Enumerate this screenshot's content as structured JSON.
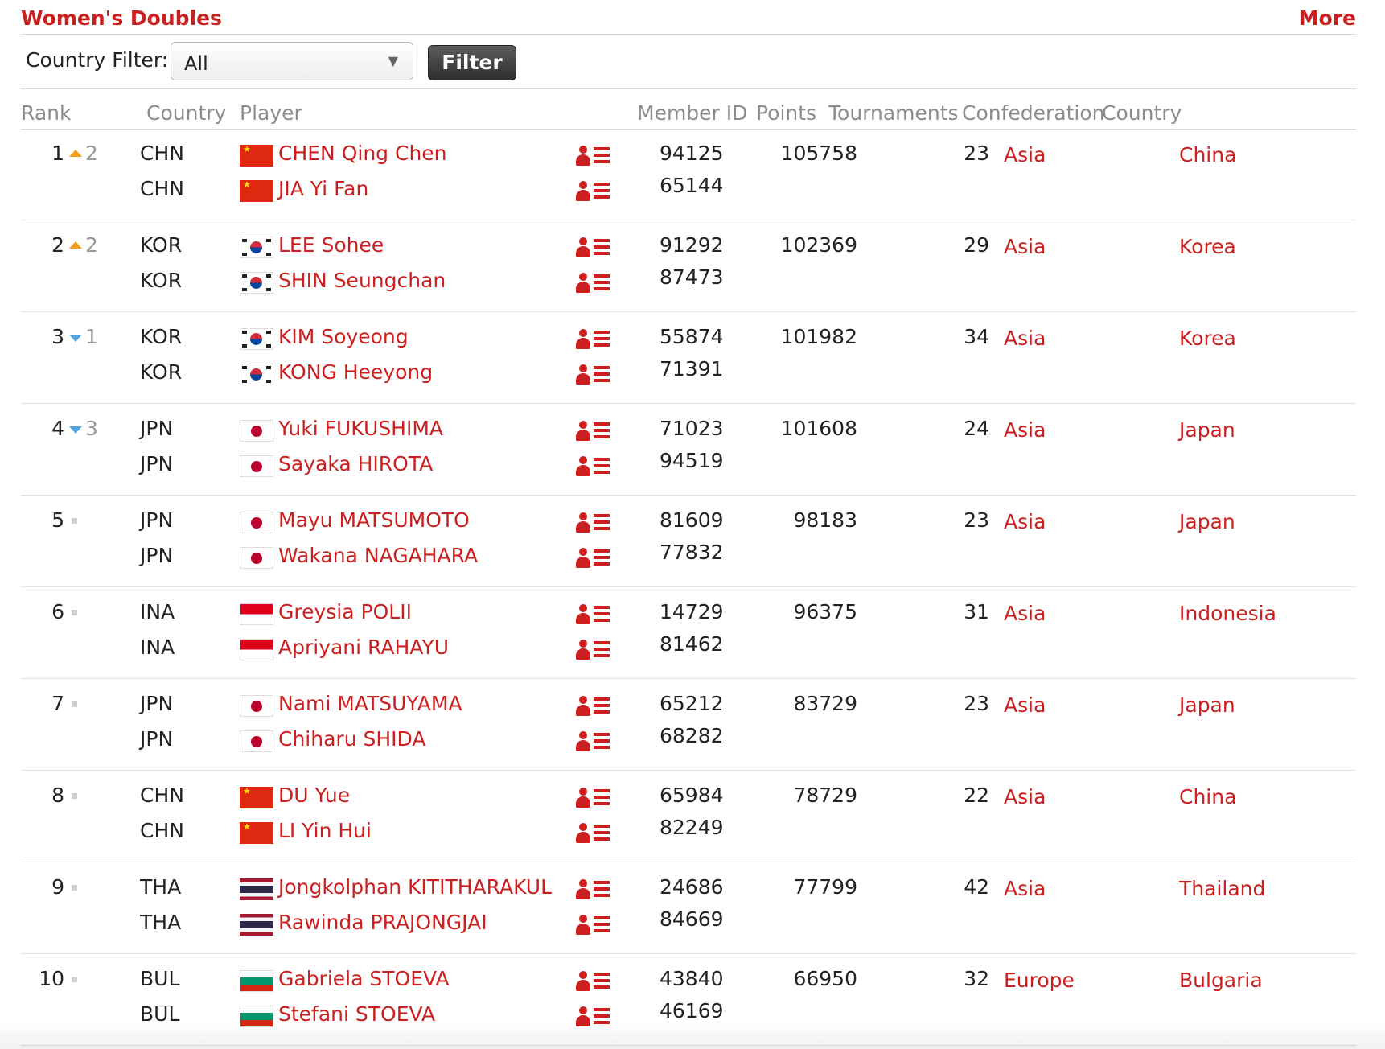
{
  "header": {
    "title": "Women's Doubles",
    "more": "More"
  },
  "filter": {
    "label": "Country Filter:",
    "selected": "All",
    "button": "Filter"
  },
  "columns": {
    "rank": "Rank",
    "country_code": "Country",
    "player": "Player",
    "member_id": "Member ID",
    "points": "Points",
    "tournaments": "Tournaments",
    "confederation": "Confederation",
    "country": "Country"
  },
  "rows": [
    {
      "rank": "1",
      "move": "up",
      "move_by": "2",
      "points": "105758",
      "tournaments": "23",
      "confederation": "Asia",
      "country": "China",
      "players": [
        {
          "code": "CHN",
          "flag": "chn",
          "name": "CHEN Qing Chen",
          "member_id": "94125"
        },
        {
          "code": "CHN",
          "flag": "chn",
          "name": "JIA Yi Fan",
          "member_id": "65144"
        }
      ]
    },
    {
      "rank": "2",
      "move": "up",
      "move_by": "2",
      "points": "102369",
      "tournaments": "29",
      "confederation": "Asia",
      "country": "Korea",
      "players": [
        {
          "code": "KOR",
          "flag": "kor",
          "name": "LEE Sohee",
          "member_id": "91292"
        },
        {
          "code": "KOR",
          "flag": "kor",
          "name": "SHIN Seungchan",
          "member_id": "87473"
        }
      ]
    },
    {
      "rank": "3",
      "move": "down",
      "move_by": "1",
      "points": "101982",
      "tournaments": "34",
      "confederation": "Asia",
      "country": "Korea",
      "players": [
        {
          "code": "KOR",
          "flag": "kor",
          "name": "KIM Soyeong",
          "member_id": "55874"
        },
        {
          "code": "KOR",
          "flag": "kor",
          "name": "KONG Heeyong",
          "member_id": "71391"
        }
      ]
    },
    {
      "rank": "4",
      "move": "down",
      "move_by": "3",
      "points": "101608",
      "tournaments": "24",
      "confederation": "Asia",
      "country": "Japan",
      "players": [
        {
          "code": "JPN",
          "flag": "jpn",
          "name": "Yuki FUKUSHIMA",
          "member_id": "71023"
        },
        {
          "code": "JPN",
          "flag": "jpn",
          "name": "Sayaka HIROTA",
          "member_id": "94519"
        }
      ]
    },
    {
      "rank": "5",
      "move": "same",
      "move_by": "",
      "points": "98183",
      "tournaments": "23",
      "confederation": "Asia",
      "country": "Japan",
      "players": [
        {
          "code": "JPN",
          "flag": "jpn",
          "name": "Mayu MATSUMOTO",
          "member_id": "81609"
        },
        {
          "code": "JPN",
          "flag": "jpn",
          "name": "Wakana NAGAHARA",
          "member_id": "77832"
        }
      ]
    },
    {
      "rank": "6",
      "move": "same",
      "move_by": "",
      "points": "96375",
      "tournaments": "31",
      "confederation": "Asia",
      "country": "Indonesia",
      "players": [
        {
          "code": "INA",
          "flag": "ina",
          "name": "Greysia POLII",
          "member_id": "14729"
        },
        {
          "code": "INA",
          "flag": "ina",
          "name": "Apriyani RAHAYU",
          "member_id": "81462"
        }
      ]
    },
    {
      "rank": "7",
      "move": "same",
      "move_by": "",
      "points": "83729",
      "tournaments": "23",
      "confederation": "Asia",
      "country": "Japan",
      "players": [
        {
          "code": "JPN",
          "flag": "jpn",
          "name": "Nami MATSUYAMA",
          "member_id": "65212"
        },
        {
          "code": "JPN",
          "flag": "jpn",
          "name": "Chiharu SHIDA",
          "member_id": "68282"
        }
      ]
    },
    {
      "rank": "8",
      "move": "same",
      "move_by": "",
      "points": "78729",
      "tournaments": "22",
      "confederation": "Asia",
      "country": "China",
      "players": [
        {
          "code": "CHN",
          "flag": "chn",
          "name": "DU Yue",
          "member_id": "65984"
        },
        {
          "code": "CHN",
          "flag": "chn",
          "name": "LI Yin Hui",
          "member_id": "82249"
        }
      ]
    },
    {
      "rank": "9",
      "move": "same",
      "move_by": "",
      "points": "77799",
      "tournaments": "42",
      "confederation": "Asia",
      "country": "Thailand",
      "players": [
        {
          "code": "THA",
          "flag": "tha",
          "name": "Jongkolphan KITITHARAKUL",
          "member_id": "24686"
        },
        {
          "code": "THA",
          "flag": "tha",
          "name": "Rawinda PRAJONGJAI",
          "member_id": "84669"
        }
      ]
    },
    {
      "rank": "10",
      "move": "same",
      "move_by": "",
      "points": "66950",
      "tournaments": "32",
      "confederation": "Europe",
      "country": "Bulgaria",
      "players": [
        {
          "code": "BUL",
          "flag": "bul",
          "name": "Gabriela STOEVA",
          "member_id": "43840"
        },
        {
          "code": "BUL",
          "flag": "bul",
          "name": "Stefani STOEVA",
          "member_id": "46169"
        }
      ]
    }
  ],
  "colors": {
    "accent": "#cc1f1f",
    "move_up": "#f0a01e",
    "move_down": "#4ea4e0"
  },
  "icons": {
    "profile": "player-profile-icon",
    "dropdown": "chevron-down-icon"
  }
}
